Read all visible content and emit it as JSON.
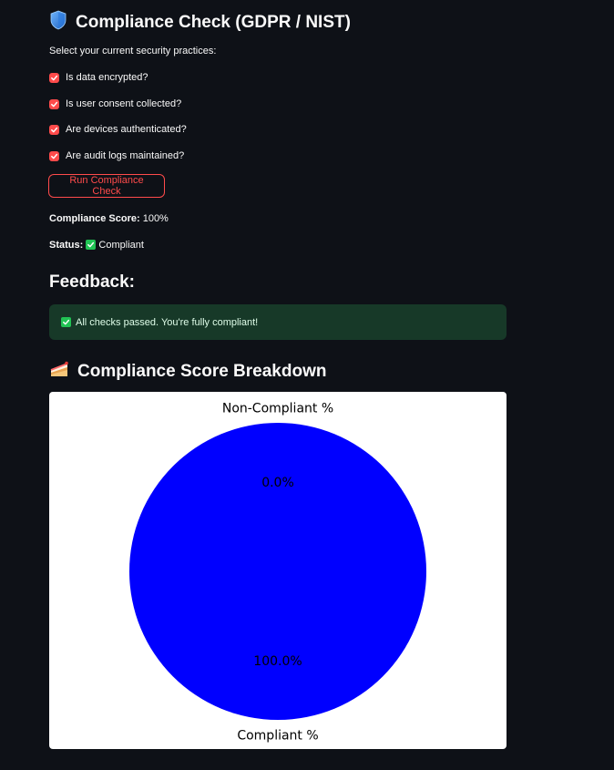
{
  "header": {
    "title": "Compliance Check (GDPR / NIST)",
    "icon": "shield-icon"
  },
  "prompt": "Select your current security practices:",
  "checkboxes": [
    {
      "label": "Is data encrypted?",
      "checked": true
    },
    {
      "label": "Is user consent collected?",
      "checked": true
    },
    {
      "label": "Are devices authenticated?",
      "checked": true
    },
    {
      "label": "Are audit logs maintained?",
      "checked": true
    }
  ],
  "run_button": {
    "label": "Run Compliance Check"
  },
  "score": {
    "label": "Compliance Score:",
    "value": "100%"
  },
  "status": {
    "label": "Status:",
    "value": "Compliant"
  },
  "feedback": {
    "heading": "Feedback:",
    "message": "All checks passed. You're fully compliant!"
  },
  "breakdown": {
    "heading": "Compliance Score Breakdown",
    "icon": "cake-icon"
  },
  "colors": {
    "accent": "#ff4b4b",
    "success_bg": "#173928",
    "success": "#21c354",
    "pie_compliant": "#0000ff",
    "background": "#0e1117"
  },
  "chart_data": {
    "type": "pie",
    "categories": [
      "Compliant %",
      "Non-Compliant %"
    ],
    "values": [
      100,
      0
    ],
    "slice_labels": [
      "100.0%",
      "0.0%"
    ],
    "colors": [
      "#0000ff",
      "#ff7f0e"
    ],
    "title": "",
    "legend": "none"
  }
}
